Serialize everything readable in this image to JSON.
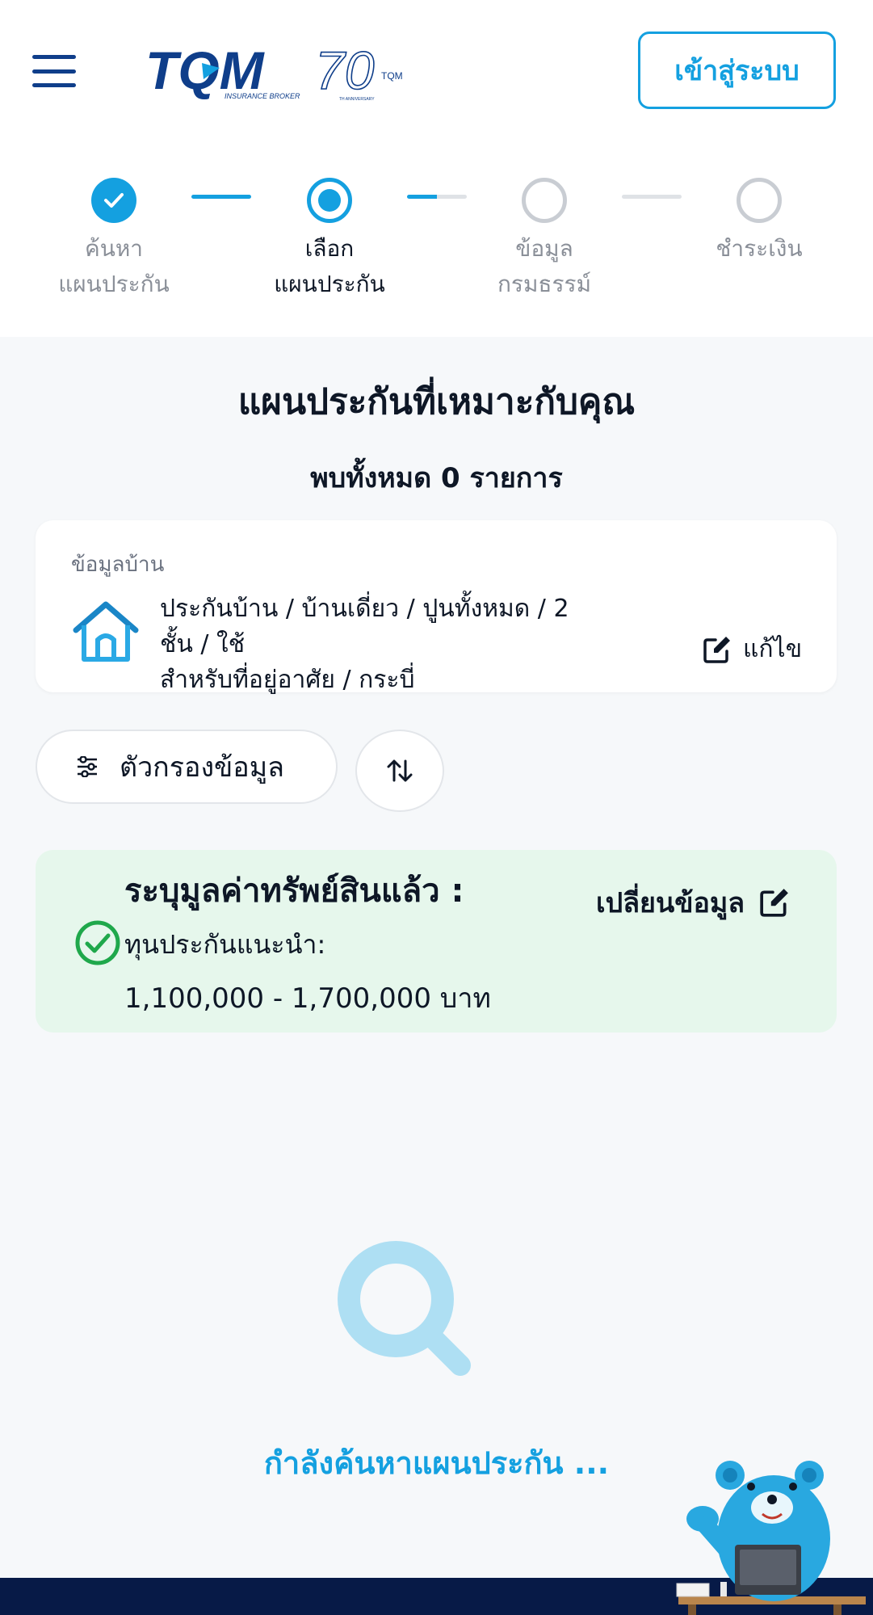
{
  "header": {
    "brand": "TQM",
    "brand_sub": "INSURANCE BROKER",
    "anniversary": "70",
    "anniversary_brand": "TQM",
    "anniversary_sub": "TH ANNIVERSARY",
    "login_label": "เข้าสู่ระบบ"
  },
  "stepper": {
    "steps": [
      {
        "line1": "ค้นหา",
        "line2": "แผนประกัน",
        "status": "done"
      },
      {
        "line1": "เลือก",
        "line2": "แผนประกัน",
        "status": "current"
      },
      {
        "line1": "ข้อมูล",
        "line2": "กรมธรรม์",
        "status": "todo"
      },
      {
        "line1": "ชำระเงิน",
        "line2": "",
        "status": "todo"
      }
    ]
  },
  "main": {
    "title": "แผนประกันที่เหมาะกับคุณ",
    "result_count": "พบทั้งหมด 0 รายการ"
  },
  "home_card": {
    "label": "ข้อมูลบ้าน",
    "details_line1": "ประกันบ้าน / บ้านเดี่ยว / ปูนทั้งหมด / 2 ชั้น / ใช้",
    "details_line2": "สำหรับที่อยู่อาศัย / กระบี่",
    "edit_label": "แก้ไข"
  },
  "toolbar": {
    "filter_label": "ตัวกรองข้อมูล"
  },
  "asset_card": {
    "title": "ระบุมูลค่าทรัพย์สินแล้ว :",
    "subtitle": "ทุนประกันแนะนำ:",
    "range": "1,100,000 - 1,700,000 บาท",
    "change_label": "เปลี่ยนข้อมูล"
  },
  "status": {
    "searching_text": "กำลังค้นหาแผนประกัน ..."
  },
  "colors": {
    "accent": "#14a0e0",
    "brand_navy": "#0f3e8a",
    "success": "#1fa84b",
    "footer": "#071a47",
    "asset_bg": "#e6f7ec"
  }
}
